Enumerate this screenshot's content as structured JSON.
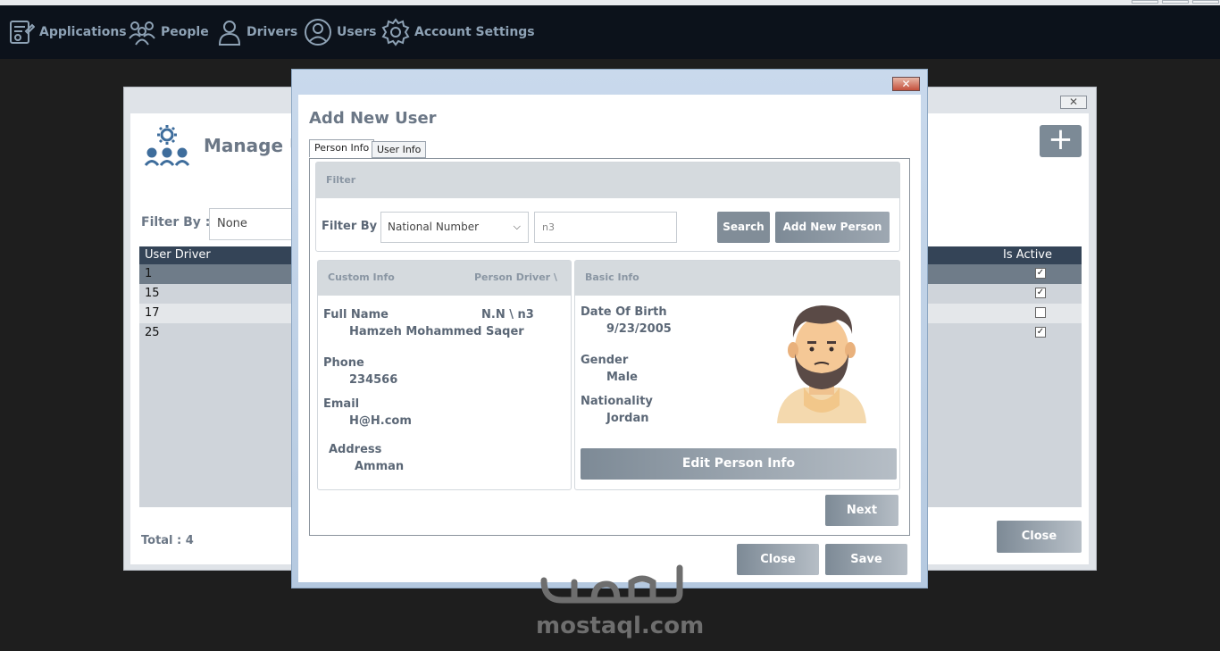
{
  "nav": {
    "items": [
      {
        "label": "Applications",
        "icon": "applications-icon"
      },
      {
        "label": "People",
        "icon": "people-icon"
      },
      {
        "label": "Drivers",
        "icon": "drivers-icon"
      },
      {
        "label": "Users",
        "icon": "users-icon"
      },
      {
        "label": "Account Settings",
        "icon": "gear-icon"
      }
    ]
  },
  "manage_window": {
    "title": "Manage Us",
    "filter_label": "Filter By :",
    "filter_value": "None",
    "columns": {
      "first": "User Driver",
      "last": "Is Active"
    },
    "rows": [
      {
        "id": "1",
        "active": true
      },
      {
        "id": "15",
        "active": true
      },
      {
        "id": "17",
        "active": false
      },
      {
        "id": "25",
        "active": true
      }
    ],
    "total": "Total : 4",
    "close_label": "Close"
  },
  "dialog": {
    "title": "Add New User",
    "tabs": [
      "Person Info",
      "User Info"
    ],
    "filter": {
      "header": "Filter",
      "label": "Filter By",
      "selected": "National Number",
      "input_value": "n3",
      "search_label": "Search",
      "add_person_label": "Add New Person"
    },
    "custom_info": {
      "header": "Custom Info",
      "header_right": "Person Driver \\",
      "full_name_label": "Full Name",
      "national_no": "N.N \\ n3",
      "full_name": "Hamzeh Mohammed Saqer",
      "phone_label": "Phone",
      "phone": "234566",
      "email_label": "Email",
      "email": "H@H.com",
      "address_label": "Address",
      "address": "Amman"
    },
    "basic_info": {
      "header": "Basic Info",
      "dob_label": "Date Of Birth",
      "dob": "9/23/2005",
      "gender_label": "Gender",
      "gender": "Male",
      "nationality_label": "Nationality",
      "nationality": "Jordan",
      "edit_label": "Edit Person Info"
    },
    "next_label": "Next",
    "close_label": "Close",
    "save_label": "Save"
  },
  "watermark": "mostaql.com",
  "colors": {
    "navbar": "#0c121b",
    "nav_text": "#8ea2b5",
    "grid_header": "#344457",
    "button": "#7d8a96"
  }
}
